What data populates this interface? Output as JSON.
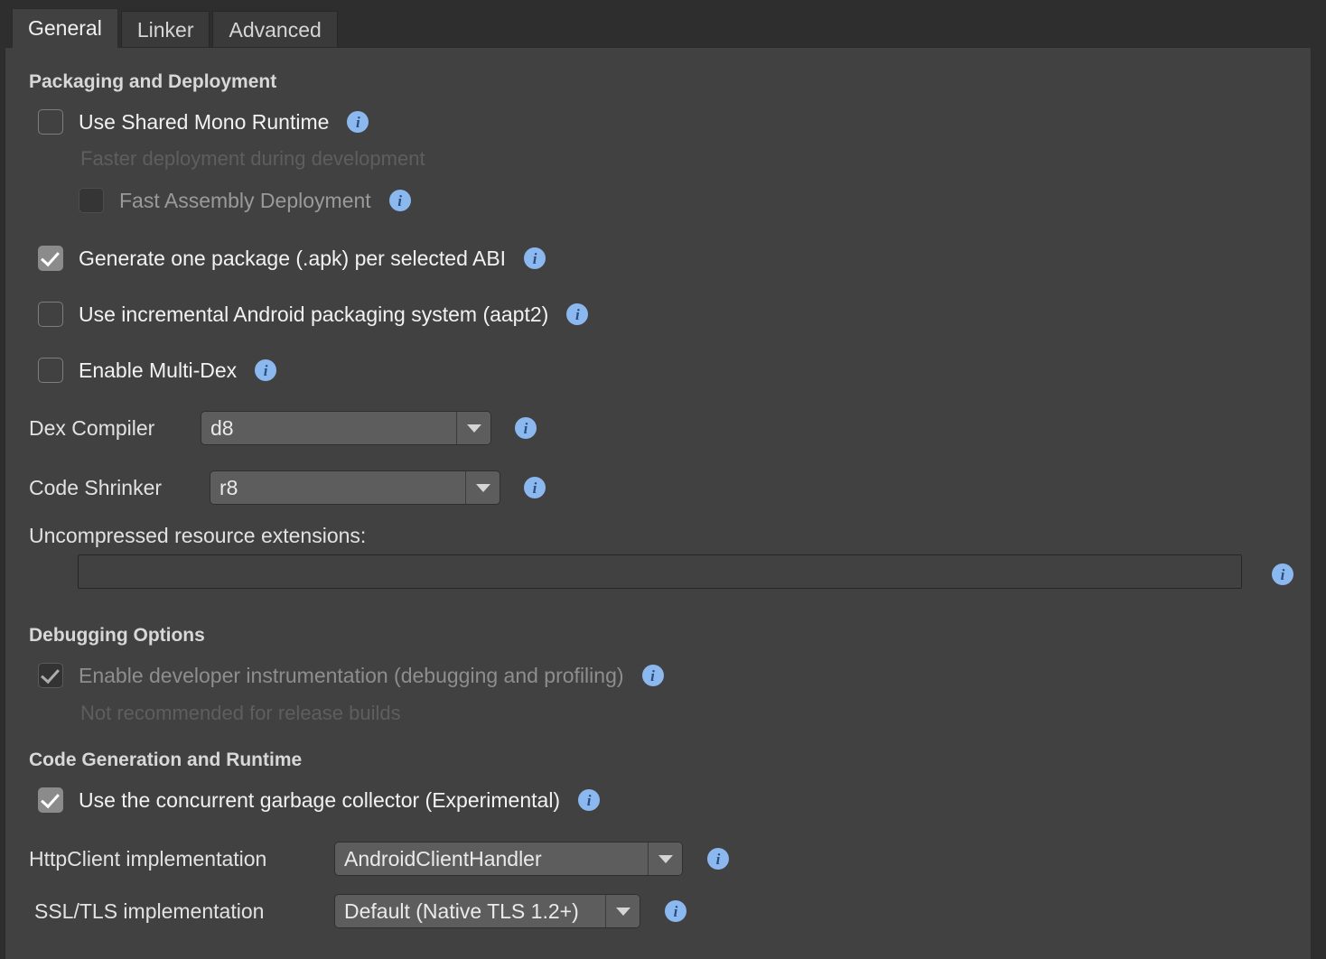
{
  "tabs": [
    {
      "label": "General",
      "active": true
    },
    {
      "label": "Linker",
      "active": false
    },
    {
      "label": "Advanced",
      "active": false
    }
  ],
  "sections": {
    "packaging": {
      "title": "Packaging and Deployment"
    },
    "debugging": {
      "title": "Debugging Options"
    },
    "codegen": {
      "title": "Code Generation and Runtime"
    }
  },
  "checkboxes": {
    "shared_mono": {
      "label": "Use Shared Mono Runtime",
      "state": "unchecked"
    },
    "shared_mono_helper": "Faster deployment during development",
    "fast_assembly": {
      "label": "Fast Assembly Deployment",
      "state": "disabled"
    },
    "one_package_per_abi": {
      "label": "Generate one package (.apk) per selected ABI",
      "state": "checked"
    },
    "aapt2": {
      "label": "Use incremental Android packaging system (aapt2)",
      "state": "unchecked"
    },
    "multi_dex": {
      "label": "Enable Multi-Dex",
      "state": "unchecked"
    },
    "dev_instrumentation": {
      "label": "Enable developer instrumentation (debugging and profiling)",
      "state": "disabled-checked"
    },
    "dev_instrumentation_helper": "Not recommended for release builds",
    "concurrent_gc": {
      "label": "Use the concurrent garbage collector (Experimental)",
      "state": "checked"
    }
  },
  "fields": {
    "dex_compiler": {
      "label": "Dex Compiler",
      "value": "d8"
    },
    "code_shrinker": {
      "label": "Code Shrinker",
      "value": "r8"
    },
    "uncompressed_ext": {
      "label": "Uncompressed resource extensions:",
      "value": ""
    },
    "httpclient": {
      "label": "HttpClient implementation",
      "value": "AndroidClientHandler"
    },
    "ssltls": {
      "label": "SSL/TLS implementation",
      "value": "Default (Native TLS 1.2+)"
    }
  },
  "icons": {
    "info": "i",
    "dropdown_arrow": "chevron-down-icon",
    "checkmark": "check-icon"
  },
  "colors": {
    "panel_bg": "#414141",
    "window_bg": "#2e2e2e",
    "info_badge": "#8cb8f0",
    "combo_bg": "#5d5d5d",
    "checked_box": "#8b8b8b"
  }
}
